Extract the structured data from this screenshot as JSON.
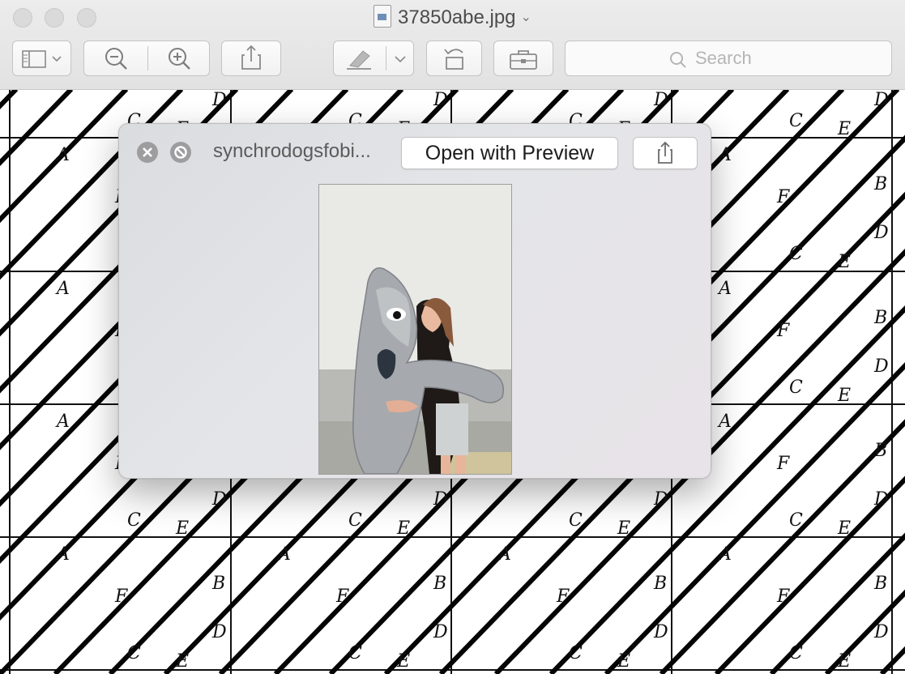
{
  "window": {
    "title": "37850abe.jpg"
  },
  "toolbar": {
    "sidebar_icon": "sidebar-icon",
    "zoom_out_icon": "zoom-out-icon",
    "zoom_in_icon": "zoom-in-icon",
    "share_icon": "share-icon",
    "markup_icon": "markup-pen-icon",
    "rotate_icon": "rotate-left-icon",
    "toolbox_icon": "toolbox-icon",
    "search_placeholder": "Search"
  },
  "background_pattern": {
    "labels": [
      "A",
      "B",
      "C",
      "D",
      "E",
      "F"
    ]
  },
  "quicklook": {
    "filename": "synchrodogsfobi...",
    "open_button_label": "Open with Preview",
    "close_icon": "close-circle-icon",
    "fullscreen_icon": "fullscreen-circle-icon",
    "share_icon": "share-icon",
    "image_description_icon": "photo-preview-icon"
  },
  "colors": {
    "chrome_bg": "#e6e6e6",
    "panel_bg": "#e2e3e6",
    "quicklook_button": "#9d9d9f"
  }
}
